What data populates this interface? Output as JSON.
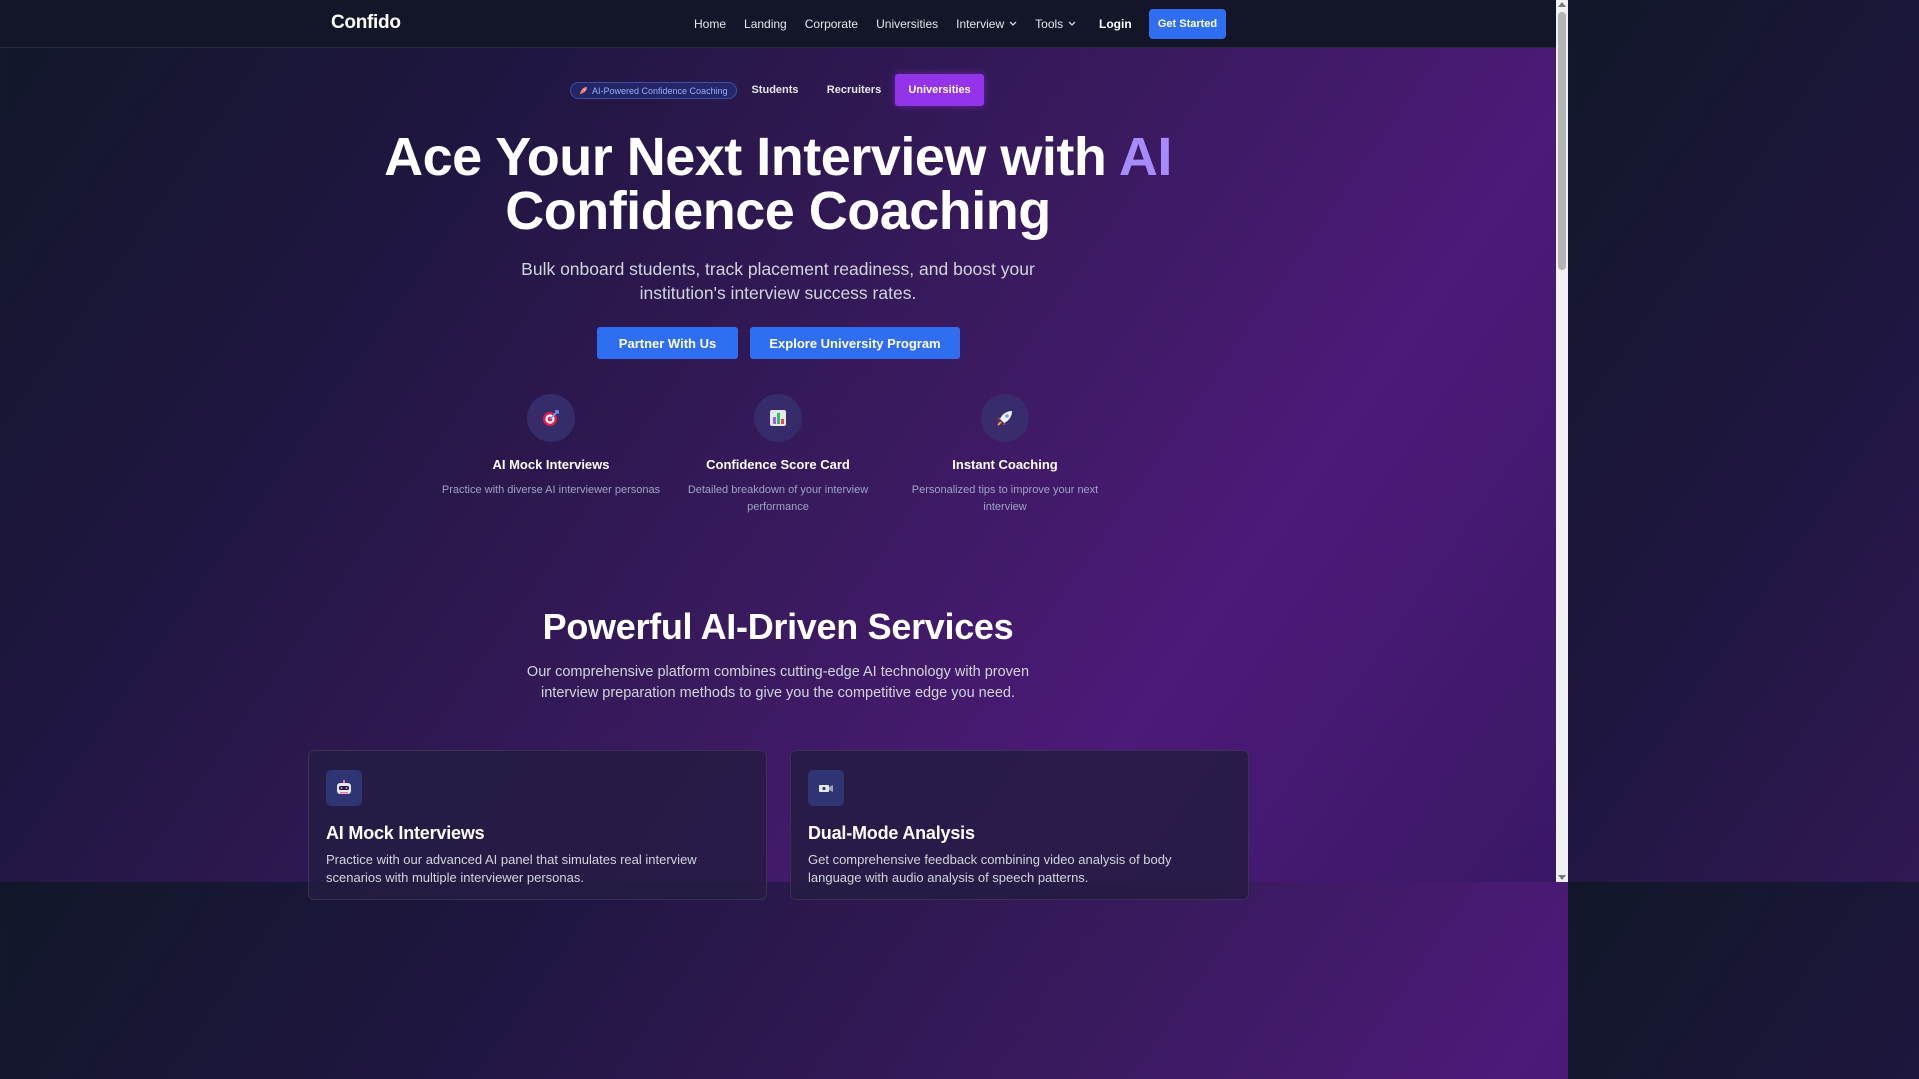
{
  "nav": {
    "logo": "Confido",
    "links": [
      "Home",
      "Landing",
      "Corporate",
      "Universities",
      "Interview",
      "Tools"
    ],
    "login": "Login",
    "cta": "Get Started"
  },
  "audience": {
    "badge": "AI-Powered Confidence Coaching",
    "tabs": [
      "Students",
      "Recruiters",
      "Universities"
    ],
    "active": "Universities"
  },
  "hero": {
    "title_line1": "Ace Your Next Interview with",
    "title_accent": "AI",
    "title_line2": "Confidence Coaching",
    "subtitle": "Bulk onboard students, track placement readiness, and boost your institution's interview success rates.",
    "primary_button": "Partner With Us",
    "secondary_button": "Explore University Program"
  },
  "features": [
    {
      "icon": "target-icon",
      "title": "AI Mock Interviews",
      "desc": "Practice with diverse AI interviewer personas"
    },
    {
      "icon": "bar-chart-icon",
      "title": "Confidence Score Card",
      "desc": "Detailed breakdown of your interview performance"
    },
    {
      "icon": "rocket-icon",
      "title": "Instant Coaching",
      "desc": "Personalized tips to improve your next interview"
    }
  ],
  "services": {
    "title": "Powerful AI-Driven Services",
    "subtitle": "Our comprehensive platform combines cutting-edge AI technology with proven interview preparation methods to give you the competitive edge you need.",
    "cards": [
      {
        "icon": "robot-icon",
        "title": "AI Mock Interviews",
        "desc": "Practice with our advanced AI panel that simulates real interview scenarios with multiple interviewer personas."
      },
      {
        "icon": "video-camera-icon",
        "title": "Dual-Mode Analysis",
        "desc": "Get comprehensive feedback combining video analysis of body language with audio analysis of speech patterns."
      }
    ]
  },
  "colors": {
    "primary": "#2f6ef0",
    "active_tab": "#9333ea",
    "accent_text": "#a78bfa"
  }
}
